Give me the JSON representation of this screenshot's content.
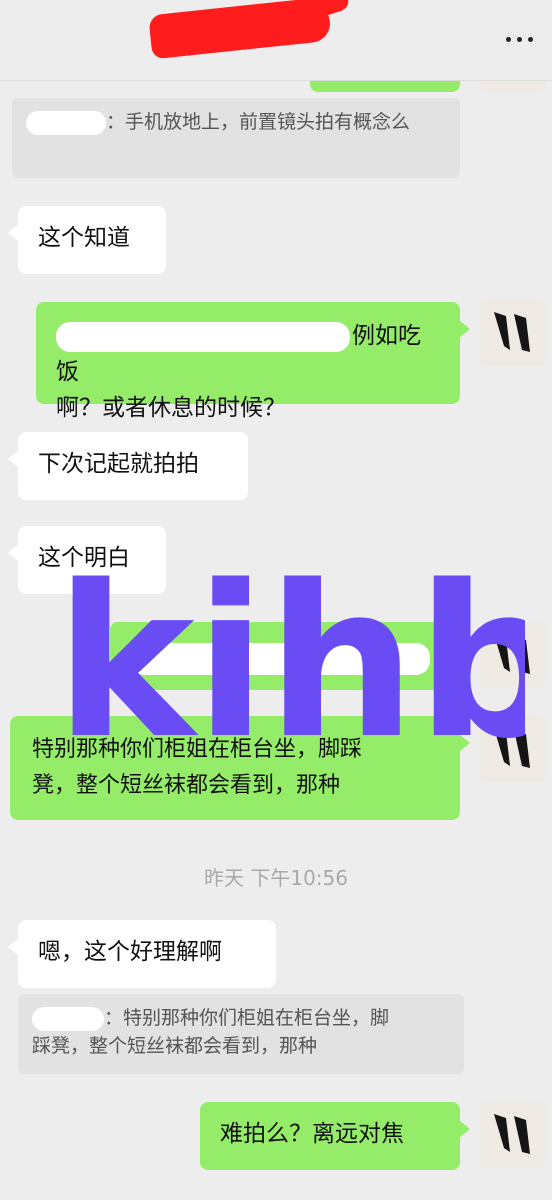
{
  "header": {
    "title_redacted": true,
    "more_icon": "more-dots-icon"
  },
  "messages": {
    "quote1": {
      "text": "：手机放地上，前置镜头拍有概念么"
    },
    "in1": {
      "text": "这个知道"
    },
    "out1": {
      "line1": "例如吃饭",
      "line2": "啊？或者休息的时候？"
    },
    "in2": {
      "text": "下次记起就拍拍"
    },
    "in3": {
      "text": "这个明白"
    },
    "out3": {
      "line1": "特别那种你们柜姐在柜台坐，脚踩",
      "line2": "凳，整个短丝袜都会看到，那种"
    },
    "timestamp": "昨天 下午10:56",
    "in4": {
      "text": "嗯，这个好理解啊"
    },
    "quote2": {
      "line1": "：特别那种你们柜姐在柜台坐，脚",
      "line2": "踩凳，整个短丝袜都会看到，那种"
    },
    "out4": {
      "text": "难拍么？离远对焦"
    }
  },
  "watermark": {
    "text": "kihb",
    "color": "#6a4cf5"
  },
  "colors": {
    "background": "#ededed",
    "bubble_out": "#95ec69",
    "bubble_in": "#ffffff",
    "redaction": "#ff1c1c"
  }
}
